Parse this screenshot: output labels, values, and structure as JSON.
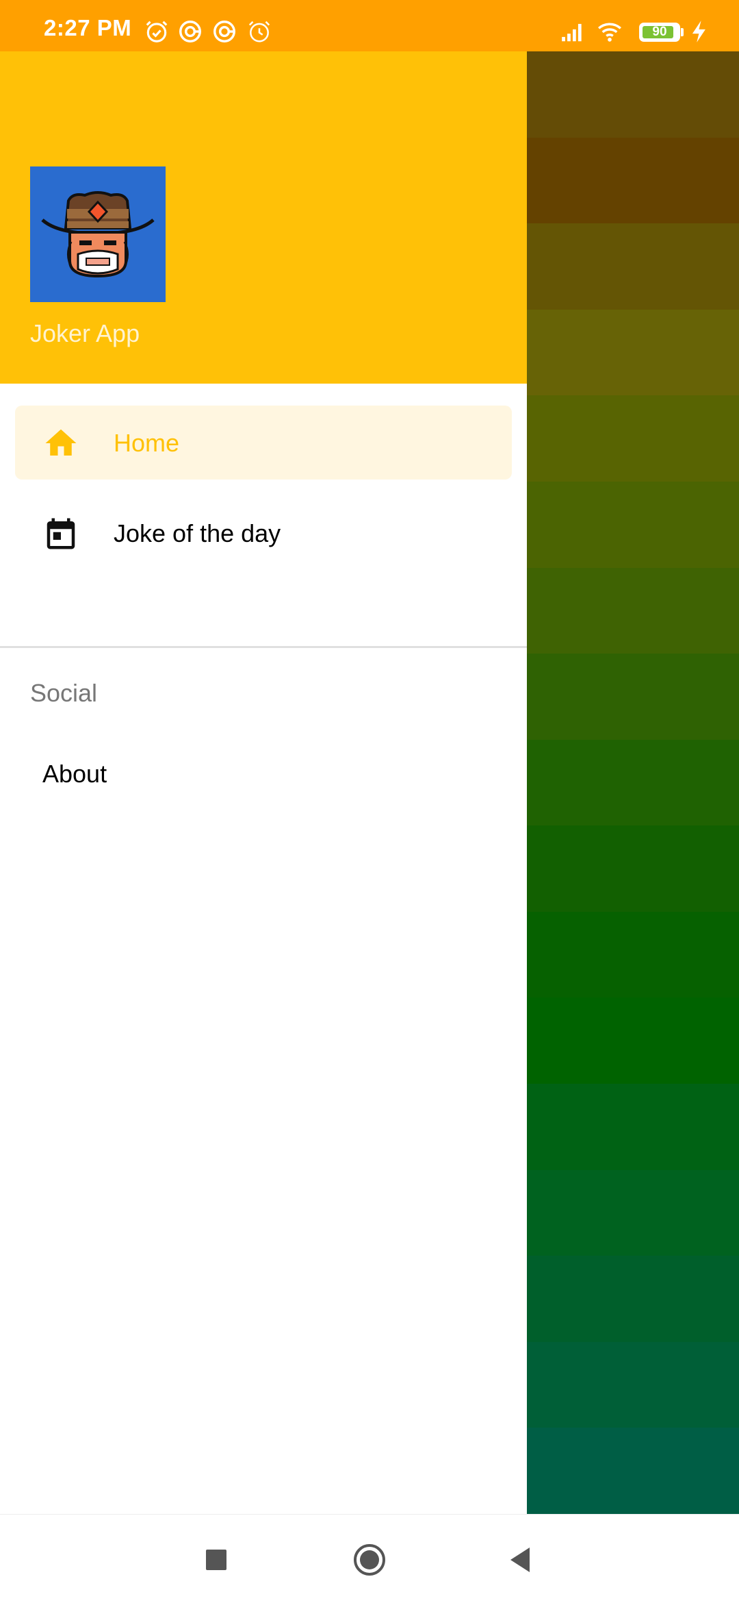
{
  "status_bar": {
    "time": "2:27 PM",
    "icons": [
      "alarm-icon",
      "sync-icon",
      "sync-icon",
      "alarm-outline-icon",
      "signal-icon",
      "wifi-icon",
      "battery-icon",
      "charging-icon"
    ],
    "battery_level": "90",
    "battery_fraction": 0.9
  },
  "drawer": {
    "header": {
      "app_name": "Joker App",
      "logo_icon": "cowboy-avatar-icon"
    },
    "menu": {
      "items": [
        {
          "label": "Home",
          "icon": "home-icon",
          "active": true
        },
        {
          "label": "Joke of the day",
          "icon": "calendar-icon",
          "active": false
        }
      ]
    },
    "section": {
      "title": "Social",
      "items": [
        {
          "label": "About"
        }
      ]
    }
  },
  "colors": {
    "status_bar": "#FFA000",
    "header": "#FFC107",
    "accent": "#FFC107",
    "active_item_bg": "#FFF6E0",
    "logo_bg": "#2A6CCF",
    "scrim_bands": [
      "#644C06",
      "#644200",
      "#645505",
      "#676306",
      "#586402",
      "#4B6402",
      "#3F6303",
      "#2F6203",
      "#1F6202",
      "#126001",
      "#066100",
      "#006300",
      "#006214",
      "#00621F",
      "#005F2B",
      "#005F37",
      "#005E45"
    ]
  },
  "nav_bar": {
    "buttons": [
      "recents-button",
      "home-button",
      "back-button"
    ]
  }
}
